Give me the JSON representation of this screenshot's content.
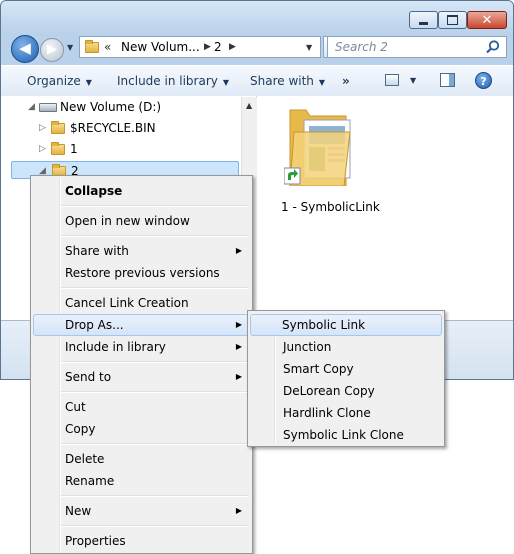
{
  "window": {
    "caption_buttons": {
      "minimize": "minimize",
      "maximize": "maximize",
      "close": "✕"
    }
  },
  "nav": {
    "back_glyph": "◀",
    "forward_glyph": "▶",
    "recent_glyph": "▼"
  },
  "address": {
    "overflow": "«",
    "crumbs": [
      "New Volum...",
      "2"
    ],
    "separator": "▶",
    "dropdown": "▼",
    "refresh_glyph": "↻"
  },
  "search": {
    "placeholder": "Search 2"
  },
  "toolbar": {
    "organize": "Organize",
    "include_in_library": "Include in library",
    "share_with": "Share with",
    "more": "»",
    "dropdown_arrow": "▼",
    "help": "?"
  },
  "navpane": {
    "items": [
      {
        "label": "New Volume (D:)",
        "expander": "◢"
      },
      {
        "label": "$RECYCLE.BIN",
        "expander": "▷"
      },
      {
        "label": "1",
        "expander": "▷"
      },
      {
        "label": "2",
        "expander": "◢"
      }
    ],
    "scroll_up": "▲"
  },
  "content": {
    "items": [
      {
        "label": "1 - SymbolicLink"
      }
    ]
  },
  "context_menu": {
    "items": [
      {
        "label": "Collapse"
      },
      {
        "label": "Open in new window"
      },
      {
        "label": "Share with"
      },
      {
        "label": "Restore previous versions"
      },
      {
        "label": "Cancel Link Creation"
      },
      {
        "label": "Drop As..."
      },
      {
        "label": "Include in library"
      },
      {
        "label": "Send to"
      },
      {
        "label": "Cut"
      },
      {
        "label": "Copy"
      },
      {
        "label": "Delete"
      },
      {
        "label": "Rename"
      },
      {
        "label": "New"
      },
      {
        "label": "Properties"
      }
    ],
    "submenu_arrow": "▶"
  },
  "drop_as_submenu": {
    "items": [
      {
        "label": "Symbolic Link"
      },
      {
        "label": "Junction"
      },
      {
        "label": "Smart Copy"
      },
      {
        "label": "DeLorean Copy"
      },
      {
        "label": "Hardlink Clone"
      },
      {
        "label": "Symbolic Link Clone"
      }
    ]
  }
}
